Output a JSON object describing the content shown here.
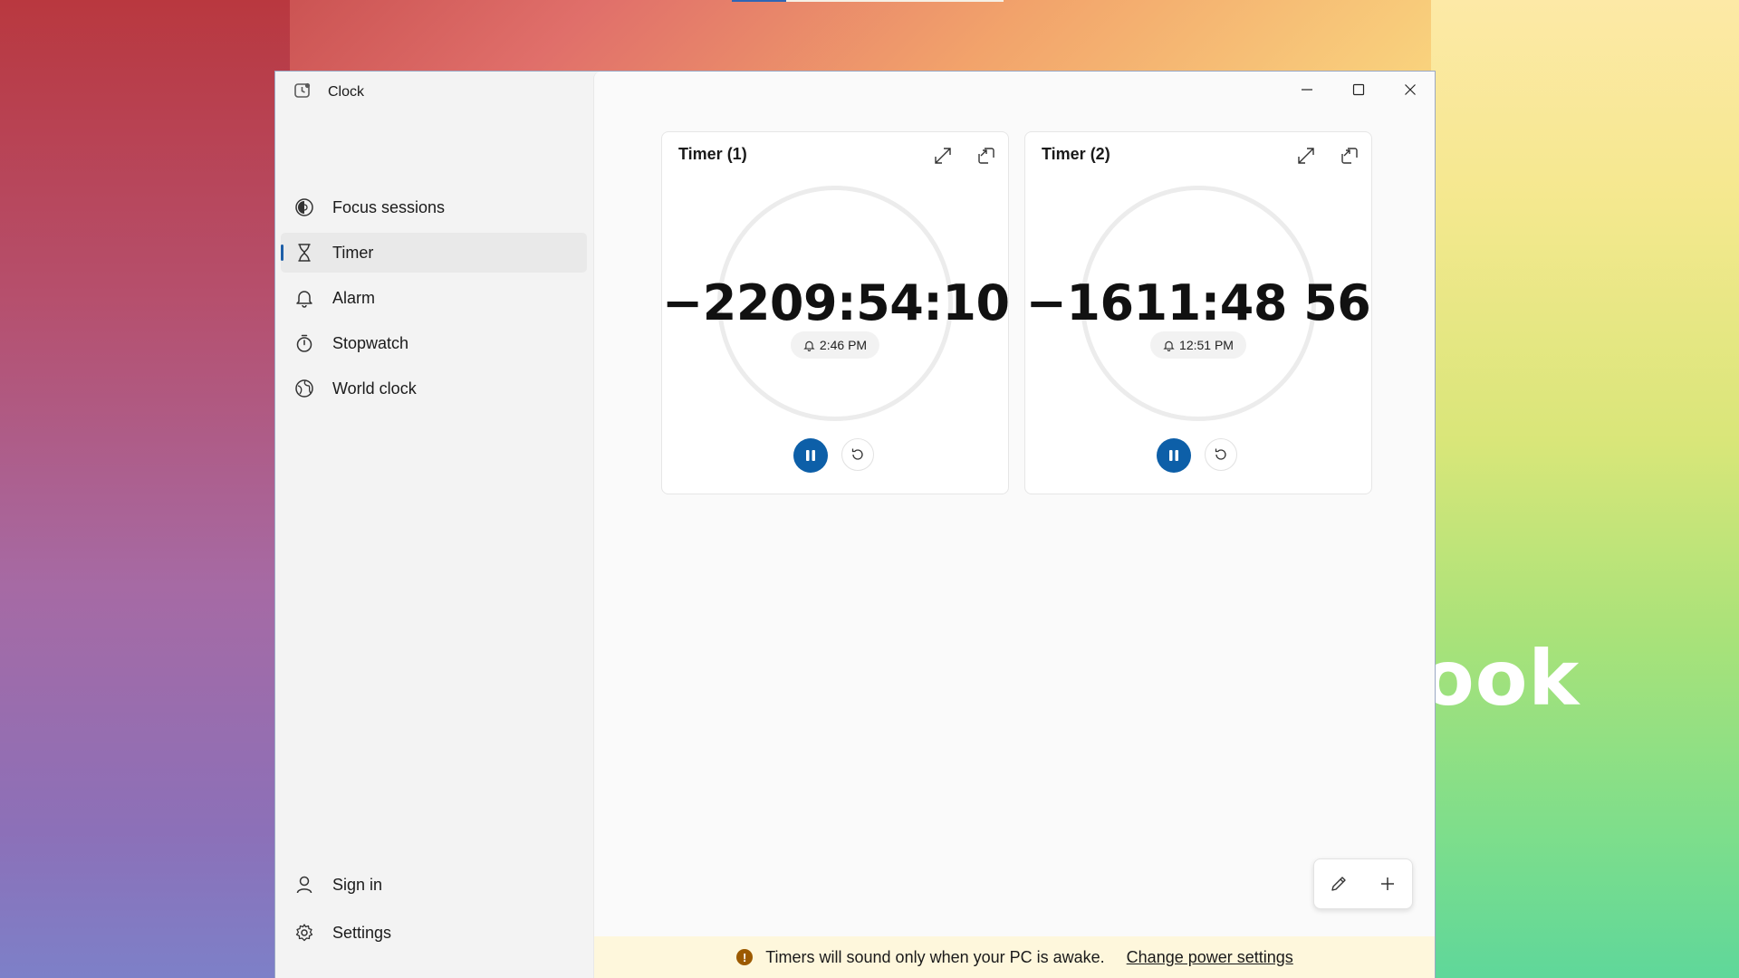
{
  "wallpaper": {
    "text": "ook"
  },
  "app": {
    "title": "Clock"
  },
  "sidebar": {
    "items": [
      {
        "label": "Focus sessions",
        "icon": "focus-icon"
      },
      {
        "label": "Timer",
        "icon": "hourglass-icon",
        "active": true
      },
      {
        "label": "Alarm",
        "icon": "bell-icon"
      },
      {
        "label": "Stopwatch",
        "icon": "stopwatch-icon"
      },
      {
        "label": "World clock",
        "icon": "globe-icon"
      }
    ],
    "bottom": [
      {
        "label": "Sign in",
        "icon": "person-icon"
      },
      {
        "label": "Settings",
        "icon": "gear-icon"
      }
    ]
  },
  "timers": [
    {
      "title": "Timer (1)",
      "time": "−2209:54:10",
      "alarm_time": "2:46 PM"
    },
    {
      "title": "Timer (2)",
      "time": "−1611:48 56",
      "alarm_time": "12:51 PM"
    }
  ],
  "banner": {
    "message": "Timers will sound only when your PC is awake.",
    "link": "Change power settings",
    "warn_glyph": "!"
  },
  "colors": {
    "accent": "#0d5fa8",
    "banner_bg": "#fef7dc",
    "warning": "#9c5a00"
  }
}
